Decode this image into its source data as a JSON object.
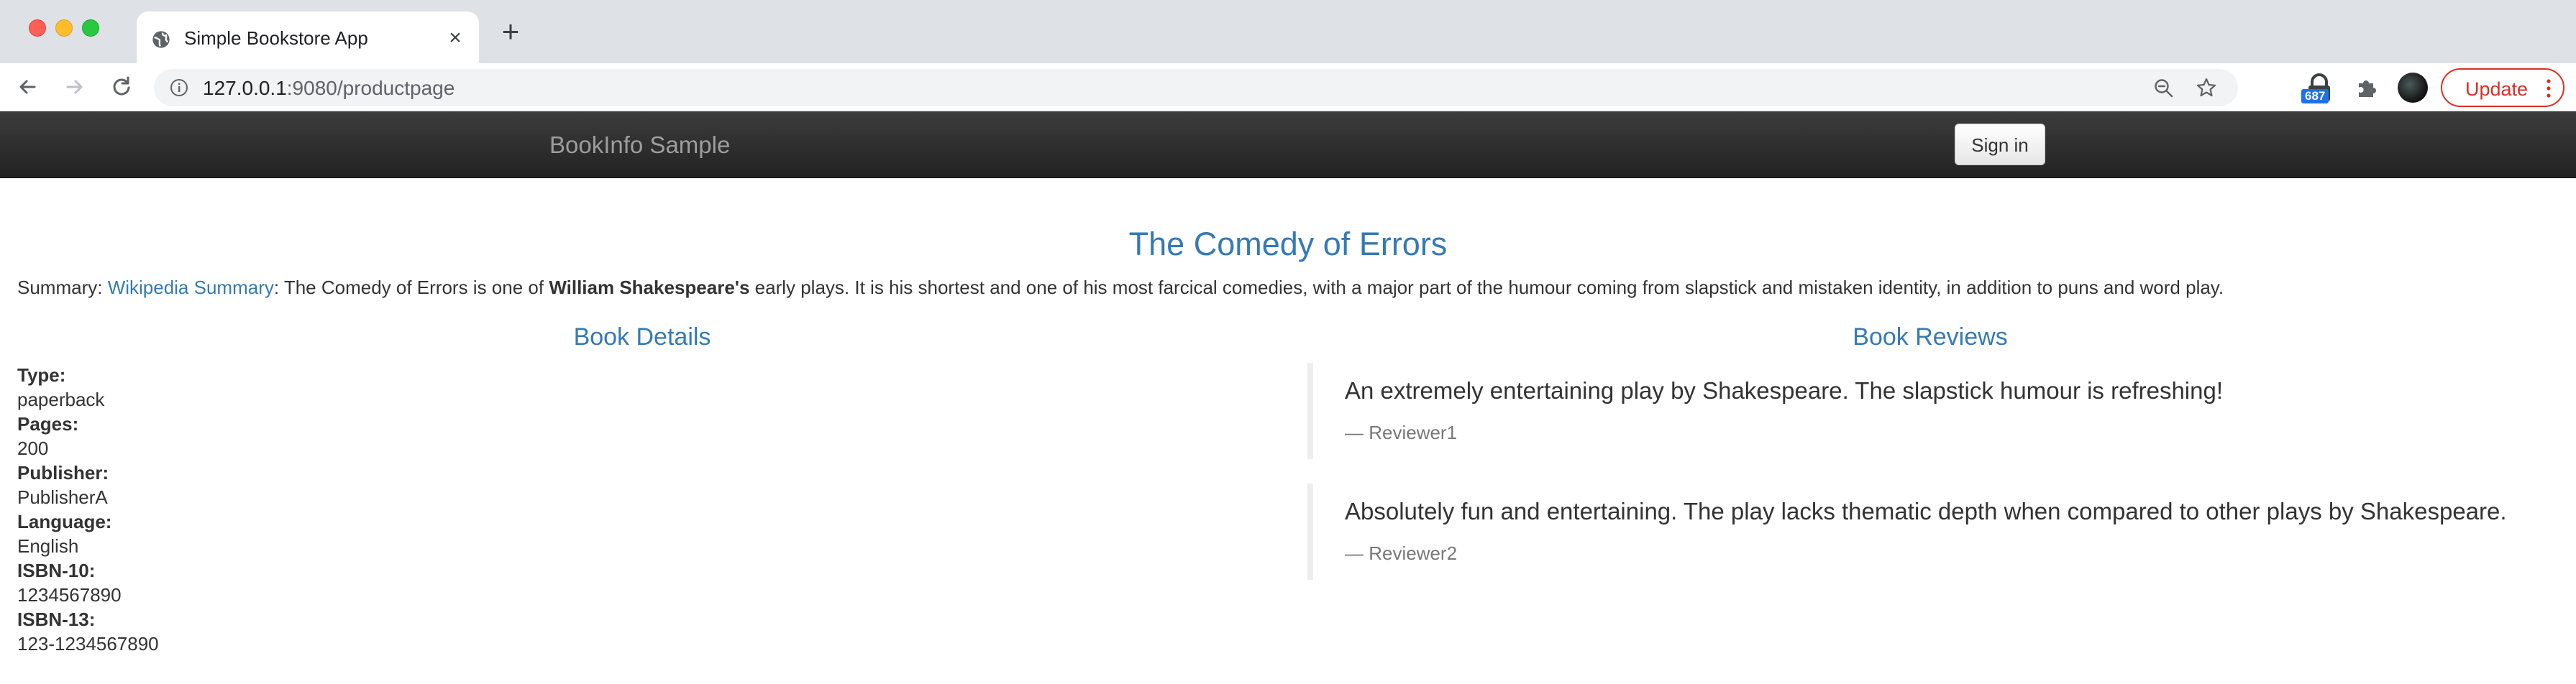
{
  "browser": {
    "tab_title": "Simple Bookstore App",
    "tab_close": "×",
    "new_tab": "+",
    "url_host": "127.0.0.1",
    "url_path": ":9080/productpage",
    "extension_badge": "687",
    "update_label": "Update",
    "icons": {
      "back": "arrow-left-icon",
      "forward": "arrow-right-icon",
      "reload": "reload-icon",
      "info": "info-icon",
      "zoom": "zoom-out-icon",
      "star": "bookmark-star-icon",
      "lock_extension": "lock-extension-icon",
      "extensions": "puzzle-icon",
      "kebab": "kebab-menu-icon"
    }
  },
  "navbar": {
    "brand": "BookInfo Sample",
    "signin_label": "Sign in",
    "background": "#222222"
  },
  "product": {
    "title": "The Comedy of Errors",
    "summary_label": "Summary: ",
    "summary_link": "Wikipedia Summary",
    "summary_text_1": ": The Comedy of Errors is one of ",
    "summary_bold": "William Shakespeare's",
    "summary_text_2": " early plays. It is his shortest and one of his most farcical comedies, with a major part of the humour coming from slapstick and mistaken identity, in addition to puns and word play."
  },
  "details": {
    "heading": "Book Details",
    "fields": [
      {
        "label": "Type:",
        "value": "paperback"
      },
      {
        "label": "Pages:",
        "value": "200"
      },
      {
        "label": "Publisher:",
        "value": "PublisherA"
      },
      {
        "label": "Language:",
        "value": "English"
      },
      {
        "label": "ISBN-10:",
        "value": "1234567890"
      },
      {
        "label": "ISBN-13:",
        "value": "123-1234567890"
      }
    ]
  },
  "reviews": {
    "heading": "Book Reviews",
    "items": [
      {
        "text": "An extremely entertaining play by Shakespeare. The slapstick humour is refreshing!",
        "author": "— Reviewer1"
      },
      {
        "text": "Absolutely fun and entertaining. The play lacks thematic depth when compared to other plays by Shakespeare.",
        "author": "— Reviewer2"
      }
    ]
  },
  "colors": {
    "link": "#337ab7",
    "update_red": "#d93025"
  }
}
